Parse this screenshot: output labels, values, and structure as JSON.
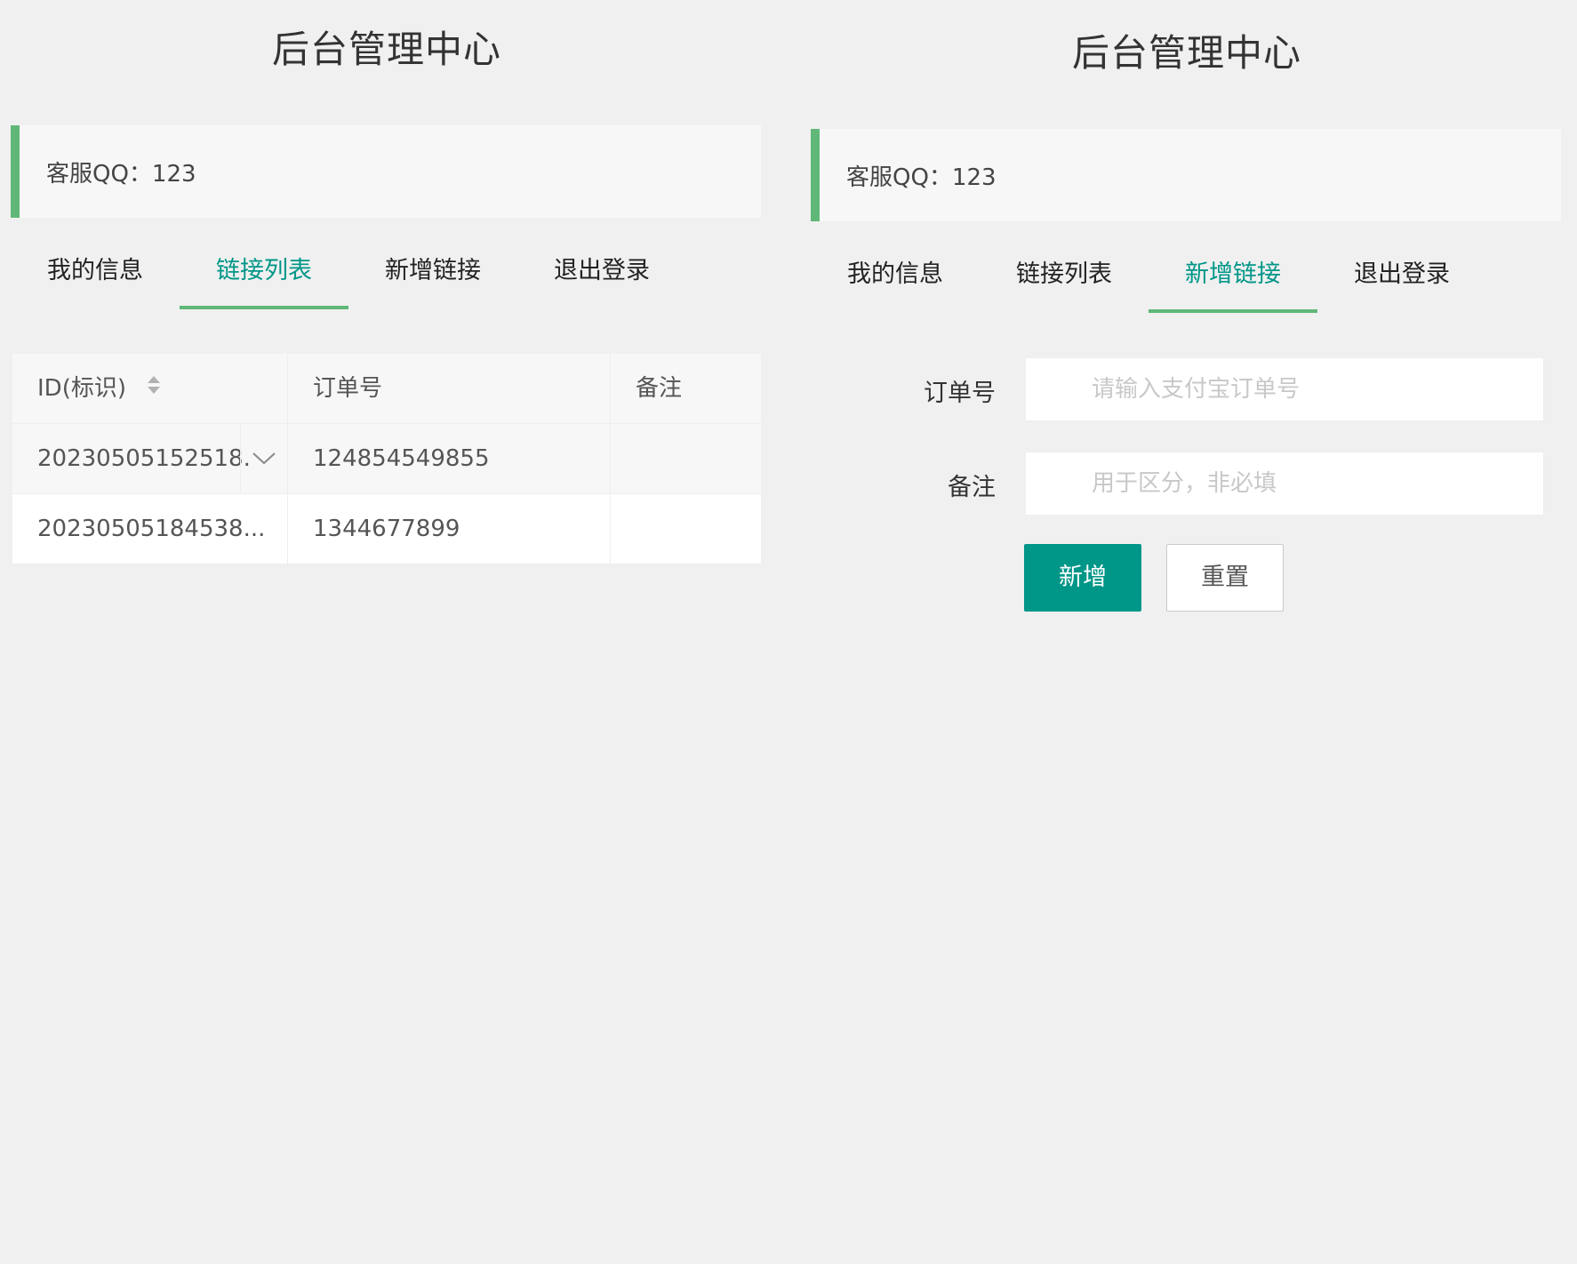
{
  "left": {
    "title": "后台管理中心",
    "notice": "客服QQ：123",
    "tabs": [
      "我的信息",
      "链接列表",
      "新增链接",
      "退出登录"
    ],
    "active_tab": "链接列表",
    "table": {
      "headers": [
        "ID(标识)",
        "订单号",
        "备注"
      ],
      "rows": [
        [
          "20230505152518.",
          "124854549855",
          ""
        ],
        [
          "20230505184538...",
          "1344677899",
          ""
        ]
      ]
    }
  },
  "right": {
    "title": "后台管理中心",
    "notice": "客服QQ：123",
    "tabs": [
      "我的信息",
      "链接列表",
      "新增链接",
      "退出登录"
    ],
    "active_tab": "新增链接",
    "form": {
      "order_label": "订单号",
      "order_placeholder": "请输入支付宝订单号",
      "remark_label": "备注",
      "remark_placeholder": "用于区分，非必填",
      "submit_label": "新增",
      "reset_label": "重置"
    }
  },
  "colors": {
    "accent": "#009688",
    "notice_bar": "#5fb878",
    "background": "#f0f0f0"
  }
}
